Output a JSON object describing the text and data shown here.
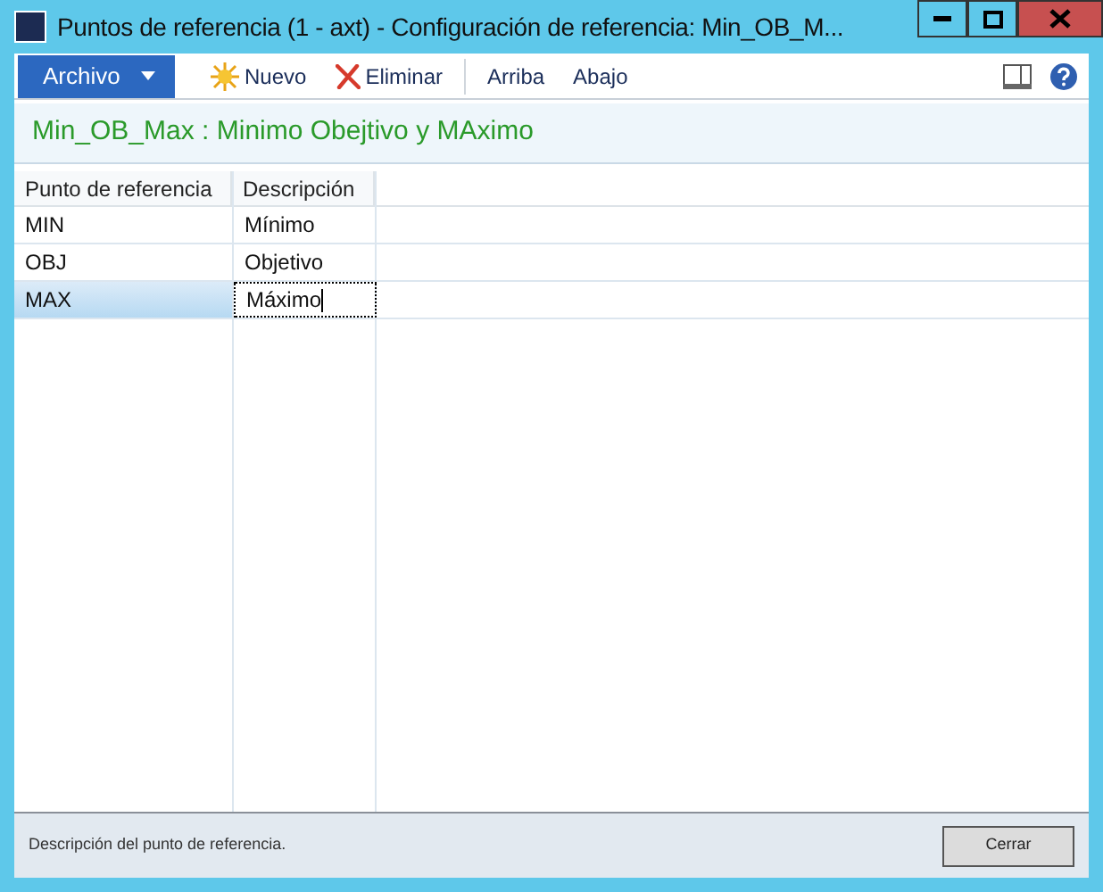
{
  "window": {
    "title": "Puntos de referencia (1 - axt) - Configuración de referencia: Min_OB_M..."
  },
  "toolbar": {
    "file_menu": "Archivo",
    "buttons": [
      {
        "kind": "new",
        "label": "Nuevo"
      },
      {
        "kind": "delete",
        "label": "Eliminar"
      },
      {
        "kind": "plain",
        "label": "Arriba"
      },
      {
        "kind": "plain",
        "label": "Abajo"
      }
    ]
  },
  "header": "Min_OB_Max : Minimo Obejtivo y MAximo",
  "table": {
    "columns": [
      "Punto de referencia",
      "Descripción"
    ],
    "rows": [
      {
        "cells": [
          "MIN",
          "Mínimo"
        ],
        "selected": false
      },
      {
        "cells": [
          "OBJ",
          "Objetivo"
        ],
        "selected": false
      },
      {
        "cells": [
          "MAX",
          "Máximo"
        ],
        "selected": true
      }
    ]
  },
  "status_bar": {
    "text": "Descripción del punto de referencia.",
    "close_button": "Cerrar"
  }
}
